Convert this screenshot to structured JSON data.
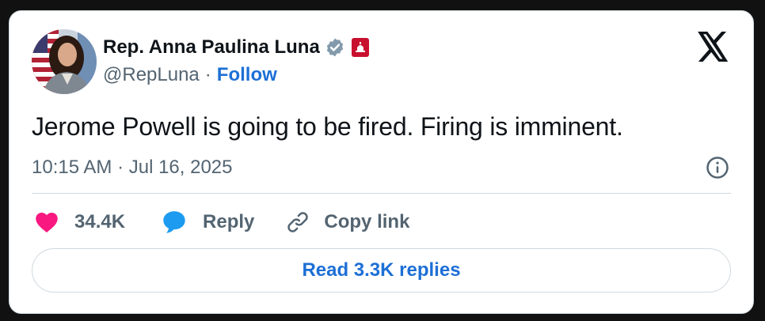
{
  "author": {
    "name": "Rep. Anna Paulina Luna",
    "handle": "@RepLuna",
    "separator": "·",
    "follow_label": "Follow",
    "avatar_icon": "profile-photo-with-us-flag",
    "verified_icon": "gray-verified-badge",
    "affiliation_icon": "us-house-affiliation-badge"
  },
  "platform_logo": "x-logo",
  "tweet": {
    "text": "Jerome Powell is going to be fired. Firing is imminent.",
    "timestamp": "10:15 AM · Jul 16, 2025"
  },
  "actions": {
    "like_count": "34.4K",
    "reply_label": "Reply",
    "copy_link_label": "Copy link"
  },
  "read_replies_label": "Read 3.3K replies",
  "colors": {
    "text": "#0f1419",
    "secondary": "#536471",
    "link": "#1d6fd6",
    "like": "#f91880",
    "reply": "#1d9bf0",
    "border": "#cfd9de",
    "affiliation_badge": "#c8102e"
  }
}
